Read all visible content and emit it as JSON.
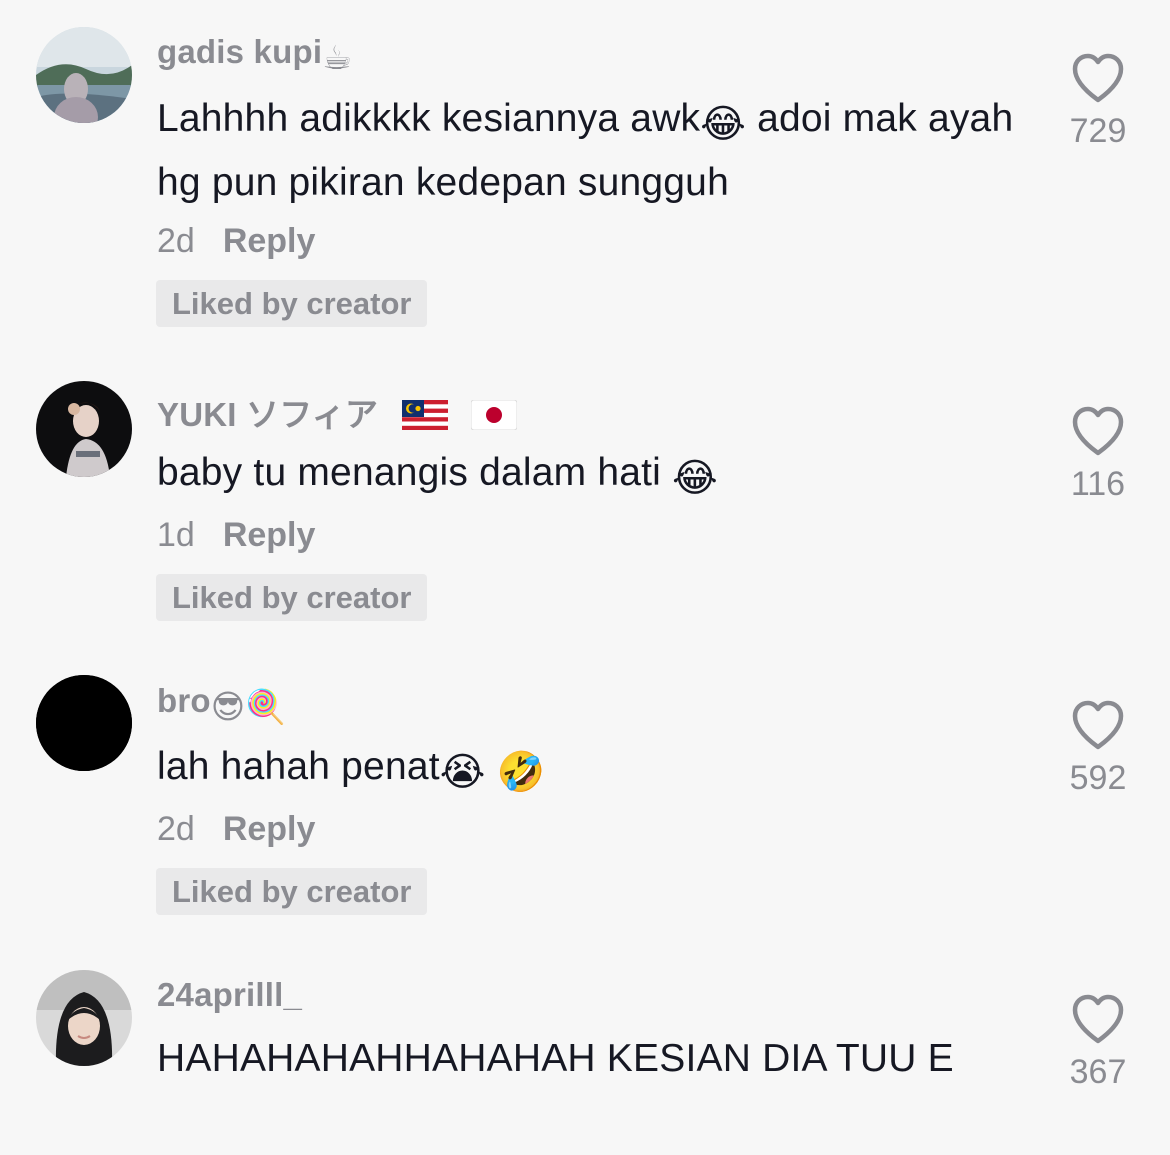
{
  "comments": [
    {
      "username": "gadis kupi",
      "username_emoji": "☕",
      "text_before": "Lahhhh adikkkk kesiannya awk",
      "text_emoji": "😂",
      "text_after": " adoi mak ayah hg pun pikiran kedepan sungguh",
      "time": "2d",
      "reply_label": "Reply",
      "badge": "Liked by creator",
      "likes": "729",
      "avatar": "landscape-photo"
    },
    {
      "username": "YUKI ソフィア",
      "flags": [
        "malaysia-flag-icon",
        "japan-flag-icon"
      ],
      "text_before": "baby tu menangis dalam hati ",
      "text_emoji": "😂",
      "time": "1d",
      "reply_label": "Reply",
      "badge": "Liked by creator",
      "likes": "116",
      "avatar": "portrait-dark"
    },
    {
      "username": "bro",
      "username_emoji": "😎🍭",
      "text_before": "lah hahah penat",
      "text_emoji": "😭 🤣",
      "time": "2d",
      "reply_label": "Reply",
      "badge": "Liked by creator",
      "likes": "592",
      "avatar": "black"
    },
    {
      "username": "24aprilll_",
      "text_before": "HAHAHAHAHHAHAHAH KESIAN DIA TUU E",
      "likes": "367",
      "avatar": "hijab-portrait"
    }
  ],
  "colors": {
    "background": "#f7f7f7",
    "secondary_text": "#8a8b91",
    "primary_text": "#161823",
    "badge_bg": "#e9e9ea"
  }
}
